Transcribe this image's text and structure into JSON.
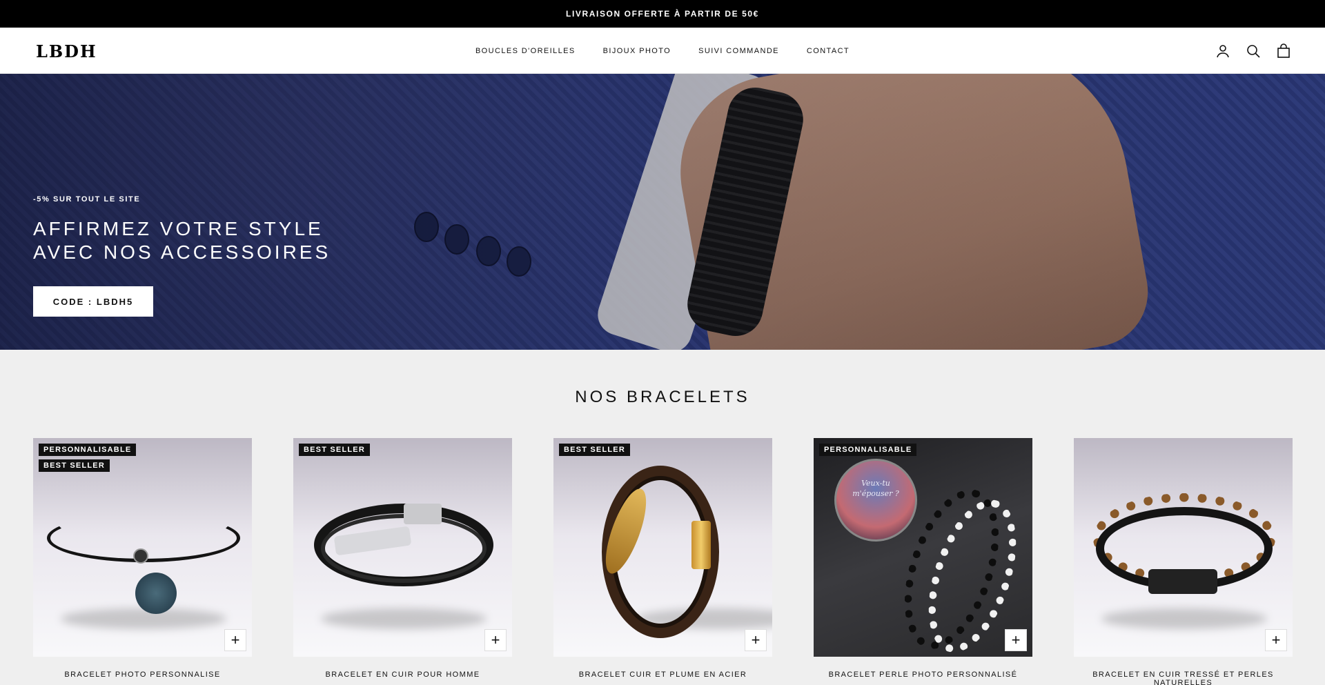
{
  "announcement": "LIVRAISON OFFERTE À PARTIR DE 50€",
  "header": {
    "logo": "LBDH",
    "nav": [
      "BOUCLES D'OREILLES",
      "BIJOUX PHOTO",
      "SUIVI COMMANDE",
      "CONTACT"
    ],
    "icons": [
      "account-icon",
      "search-icon",
      "cart-icon"
    ]
  },
  "hero": {
    "eyebrow": "-5% SUR TOUT LE SITE",
    "title_line1": "AFFIRMEZ VOTRE STYLE",
    "title_line2": "AVEC NOS ACCESSOIRES",
    "button": "CODE : LBDH5"
  },
  "section_title": "NOS BRACELETS",
  "products": [
    {
      "badges": [
        "PERSONNALISABLE",
        "BEST SELLER"
      ],
      "name": "BRACELET PHOTO PERSONNALISE"
    },
    {
      "badges": [
        "BEST SELLER"
      ],
      "name": "BRACELET EN CUIR POUR HOMME"
    },
    {
      "badges": [
        "BEST SELLER"
      ],
      "name": "BRACELET CUIR ET PLUME EN ACIER"
    },
    {
      "badges": [
        "PERSONNALISABLE"
      ],
      "name": "BRACELET PERLE PHOTO PERSONNALISÉ",
      "image_text": "Veux-tu m'épouser ?"
    },
    {
      "badges": [],
      "name": "BRACELET EN CUIR TRESSÉ ET PERLES NATURELLES"
    }
  ],
  "add_label": "+",
  "colors": {
    "announcement_bg": "#000000",
    "page_bg": "#efefef",
    "badge_bg": "#111111"
  }
}
